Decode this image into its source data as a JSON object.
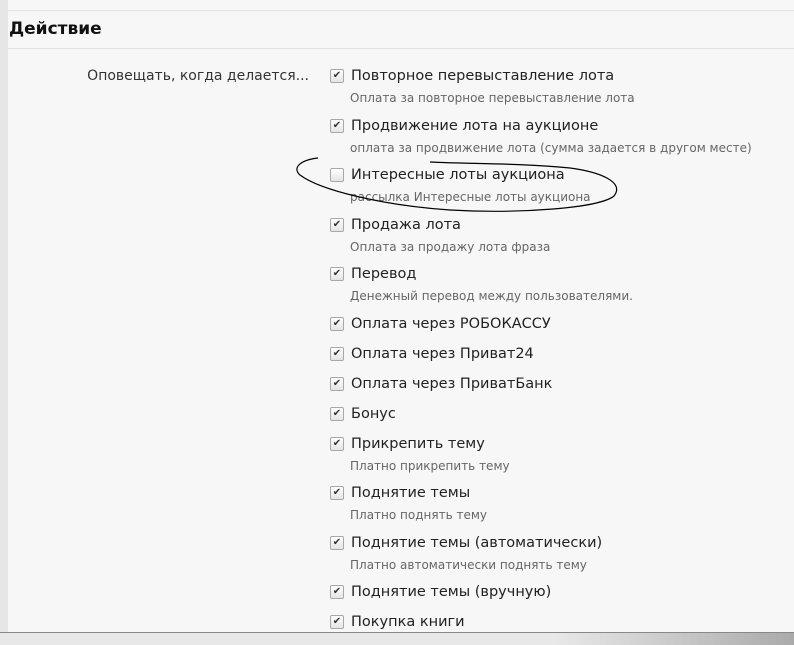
{
  "section_title": "Действие",
  "row_label": "Оповещать, когда делается...",
  "items": [
    {
      "label": "Повторное перевыставление лота",
      "desc": "Оплата за повторное перевыставление лота",
      "checked": true
    },
    {
      "label": "Продвижение лота на аукционе",
      "desc": "оплата за продвижение лота (сумма задается в другом месте)",
      "checked": true
    },
    {
      "label": "Интересные лоты аукциона",
      "desc": "рассылка Интересные лоты аукциона",
      "checked": false
    },
    {
      "label": "Продажа лота",
      "desc": "Оплата за продажу лота фраза",
      "checked": true
    },
    {
      "label": "Перевод",
      "desc": "Денежный перевод между пользователями.",
      "checked": true
    },
    {
      "label": "Оплата через РОБОКАССУ",
      "desc": null,
      "checked": true
    },
    {
      "label": "Оплата через Приват24",
      "desc": null,
      "checked": true
    },
    {
      "label": "Оплата через ПриватБанк",
      "desc": null,
      "checked": true
    },
    {
      "label": "Бонус",
      "desc": null,
      "checked": true
    },
    {
      "label": "Прикрепить тему",
      "desc": "Платно прикрепить тему",
      "checked": true
    },
    {
      "label": "Поднятие темы",
      "desc": "Платно поднять тему",
      "checked": true
    },
    {
      "label": "Поднятие темы (автоматически)",
      "desc": "Платно автоматически поднять тему",
      "checked": true
    },
    {
      "label": "Поднятие темы (вручную)",
      "desc": null,
      "checked": true
    },
    {
      "label": "Покупка книги",
      "desc": null,
      "checked": true
    }
  ]
}
